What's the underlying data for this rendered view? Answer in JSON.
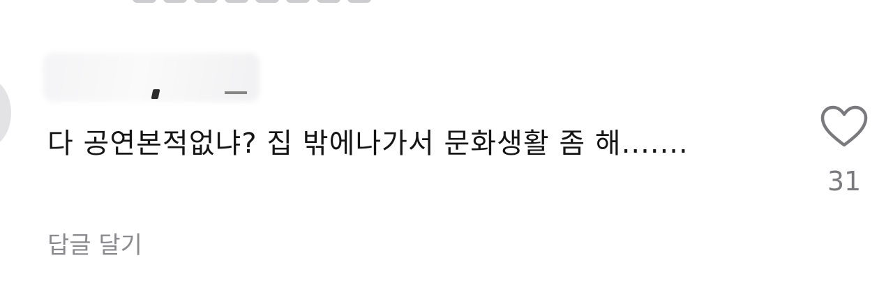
{
  "comment": {
    "text": "다 공연본적없냐? 집 밖에나가서 문화생활 좀 해.......",
    "like_count": "31",
    "reply_label": "답글 달기",
    "icons": {
      "like": "heart-outline-icon",
      "avatar": "avatar"
    }
  },
  "colors": {
    "text": "#151515",
    "muted": "#8a8a8e",
    "icon": "#7a7a7e"
  }
}
